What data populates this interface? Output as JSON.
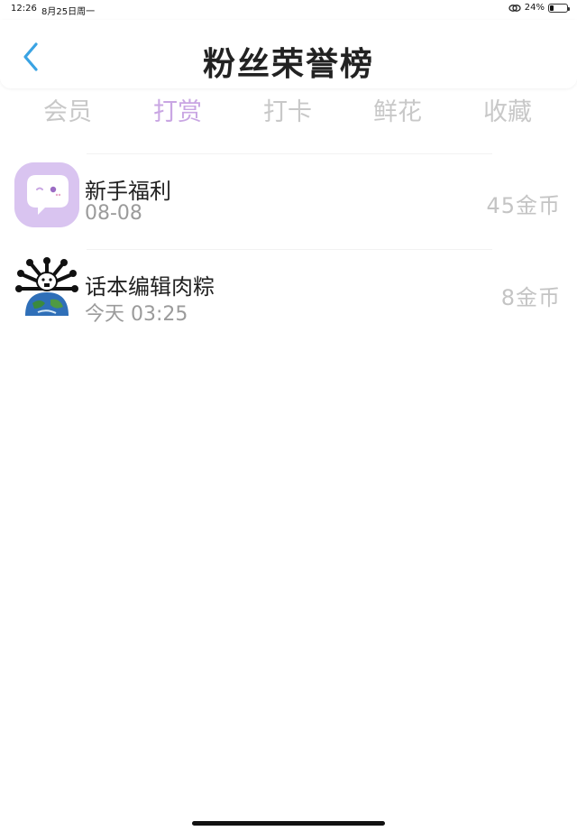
{
  "status_bar": {
    "time": "12:26",
    "date": "8月25日周一",
    "battery": "24%",
    "battery_level": 0.24
  },
  "header": {
    "title": "粉丝荣誉榜",
    "back_icon": "chevron-left-icon",
    "accent_color": "#3aa3e3"
  },
  "tabs": [
    {
      "label": "会员",
      "active": false
    },
    {
      "label": "打赏",
      "active": true
    },
    {
      "label": "打卡",
      "active": false
    },
    {
      "label": "鲜花",
      "active": false
    },
    {
      "label": "收藏",
      "active": false
    }
  ],
  "tab_active_color": "#c9a6e3",
  "list": [
    {
      "name": "新手福利",
      "time": "08-08",
      "amount": "45金币",
      "avatar": "purple-chat-bubble-avatar"
    },
    {
      "name": "话本编辑肉粽",
      "time": "今天 03:25",
      "amount": "8金币",
      "avatar": "cartoon-earth-avatar"
    }
  ]
}
